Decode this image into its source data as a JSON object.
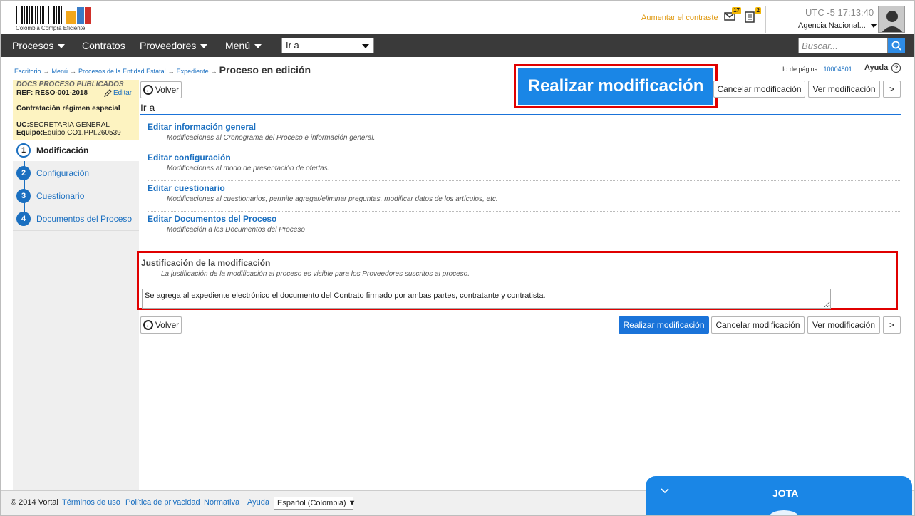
{
  "header": {
    "logo_text": "Colombia Compra Eficiente",
    "contrast_link": "Aumentar el contraste",
    "messages_count": "17",
    "notifications_count": "2",
    "timezone": "UTC -5",
    "time": "17:13:40",
    "agency": "Agencia Nacional..."
  },
  "nav": {
    "items": [
      "Procesos",
      "Contratos",
      "Proveedores",
      "Menú"
    ],
    "goto_value": "Ir a",
    "search_placeholder": "Buscar..."
  },
  "breadcrumb": {
    "items": [
      "Escritorio",
      "Menú",
      "Procesos de la Entidad Estatal",
      "Expediente"
    ],
    "current": "Proceso en edición",
    "page_id_label": "Id de página::",
    "page_id": "10004801",
    "help": "Ayuda"
  },
  "sidebar": {
    "status": "DOCS PROCESO PUBLICADOS",
    "ref": "REF: RESO-001-2018",
    "edit": "Editar",
    "regime": "Contratación régimen especial",
    "uc_label": "UC:",
    "uc_value": "SECRETARIA GENERAL",
    "team_label": "Equipo:",
    "team_value": "Equipo CO1.PPI.260539",
    "steps": [
      {
        "num": "1",
        "label": "Modificación"
      },
      {
        "num": "2",
        "label": "Configuración"
      },
      {
        "num": "3",
        "label": "Cuestionario"
      },
      {
        "num": "4",
        "label": "Documentos del Proceso"
      }
    ]
  },
  "toolbar": {
    "back": "Volver",
    "submit": "Realizar modificación",
    "cancel": "Cancelar modificación",
    "view": "Ver modificación",
    "next": ">"
  },
  "main": {
    "section_title": "Ir a",
    "options": [
      {
        "title": "Editar información general",
        "desc": "Modificaciones al Cronograma del Proceso e información general."
      },
      {
        "title": "Editar configuración",
        "desc": "Modificaciones al modo de presentación de ofertas."
      },
      {
        "title": "Editar cuestionario",
        "desc": "Modificaciones al cuestionarios, permite agregar/eliminar preguntas, modificar datos de los artículos, etc."
      },
      {
        "title": "Editar Documentos del Proceso",
        "desc": "Modificación a los Documentos del Proceso"
      }
    ],
    "justification": {
      "title": "Justificación de la modificación",
      "subtitle": "La justificación de la modificación al proceso es visible para los Proveedores suscritos al proceso.",
      "value": "Se agrega al expediente electrónico el documento del Contrato firmado por ambas partes, contratante y contratista."
    }
  },
  "footer": {
    "copyright": "© 2014 Vortal",
    "links": [
      "Términos de uso",
      "Política de privacidad",
      "Normativa",
      "Ayuda"
    ],
    "language": "Español (Colombia)"
  },
  "chat": {
    "title": "JOTA"
  },
  "colors": {
    "primary": "#1a73d9",
    "nav_bg": "#3a3a3a",
    "highlight": "#e00000"
  }
}
